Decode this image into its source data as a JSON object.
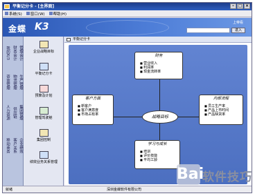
{
  "window": {
    "title": "平衡记分卡 - [主界面]"
  },
  "menu": [
    "系统(S)",
    "窗口(W)",
    "帮助(H)"
  ],
  "banner": {
    "logo": "金蝶",
    "logo_k": "K3",
    "top_link": "上帝看",
    "go_label": "进入"
  },
  "left_tabs": [
    "我的K/3",
    "财务会计",
    "管理会计",
    "资金管理",
    "物流管理",
    "生产管理",
    "人力资源",
    "供应链",
    "集团管理",
    "移动商务",
    "客户关系",
    "企业绩效"
  ],
  "tools": [
    {
      "label": "企业战略目标",
      "kind": "a"
    },
    {
      "label": "平衡记分卡",
      "kind": "b"
    },
    {
      "label": "预算及计划",
      "kind": "c"
    },
    {
      "label": "管理驾驶舱",
      "kind": "d"
    },
    {
      "label": "集团控制",
      "kind": "a"
    },
    {
      "label": "绩效业务关系管理",
      "kind": "b"
    }
  ],
  "content_title": "平衡记分卡",
  "bsc": {
    "center": "战略目标",
    "finance": {
      "title": "财务",
      "items": [
        "营业收入",
        "利润率",
        "现金流转率"
      ]
    },
    "customer": {
      "title": "客户方面",
      "items": [
        "新客户",
        "客户满意度",
        "市场占有率"
      ]
    },
    "process": {
      "title": "内部流程",
      "items": [
        "员工生产率",
        "产品上市时间",
        "产品缺货率"
      ]
    },
    "learning": {
      "title": "学习与成长",
      "items": [
        "培训",
        "评价技能",
        "平均工龄"
      ]
    }
  },
  "status": {
    "left": "就绪",
    "middle": "深圳金蝶软件有限公司"
  },
  "watermark": {
    "mark": "Bai",
    "text": "软件技巧"
  }
}
